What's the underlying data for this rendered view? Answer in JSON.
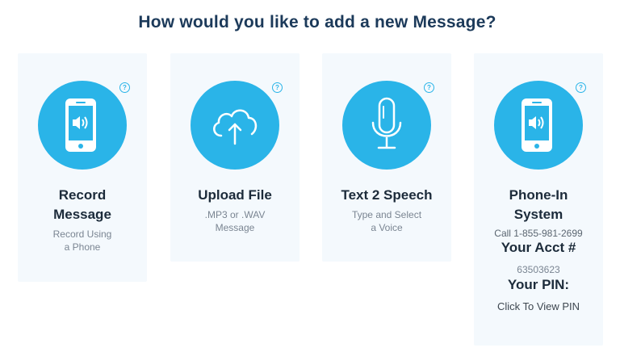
{
  "header": {
    "title": "How would you like to add a new Message?"
  },
  "help_glyph": "?",
  "options": [
    {
      "title_line1": "Record",
      "title_line2": "Message",
      "sub_line1": "Record Using",
      "sub_line2": "a Phone",
      "icon": "phone-speaker-icon"
    },
    {
      "title_line1": "Upload File",
      "sub_line1": ".MP3 or .WAV",
      "sub_line2": "Message",
      "icon": "cloud-upload-icon"
    },
    {
      "title_line1": "Text 2 Speech",
      "sub_line1": "Type and Select",
      "sub_line2": "a Voice",
      "icon": "microphone-icon"
    },
    {
      "title_line1": "Phone-In",
      "title_line2": "System",
      "call_text": "Call 1-855-981-2699",
      "acct_label": "Your Acct #",
      "acct_number": "63503623",
      "pin_label": "Your PIN:",
      "pin_link": "Click To View PIN",
      "icon": "phone-speaker-icon"
    }
  ],
  "colors": {
    "accent": "#2ab4e8",
    "title": "#1c3a5a",
    "card_bg": "#f4f9fd"
  }
}
